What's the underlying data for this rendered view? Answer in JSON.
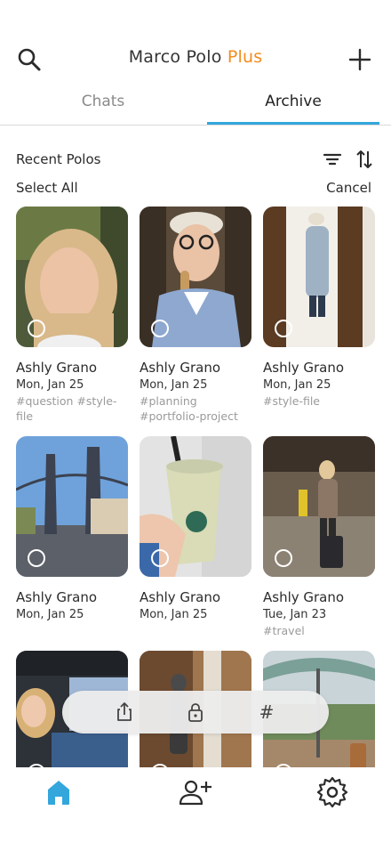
{
  "header": {
    "title_main": "Marco Polo",
    "title_plus": "Plus"
  },
  "tabs": [
    {
      "label": "Chats"
    },
    {
      "label": "Archive"
    }
  ],
  "section": {
    "title": "Recent Polos",
    "select_all": "Select All",
    "cancel": "Cancel"
  },
  "polos": [
    {
      "name": "Ashly Grano",
      "date": "Mon, Jan 25",
      "tags": "#question #style-file"
    },
    {
      "name": "Ashly Grano",
      "date": "Mon, Jan 25",
      "tags": "#planning #portfolio-project"
    },
    {
      "name": "Ashly Grano",
      "date": "Mon, Jan 25",
      "tags": "#style-file"
    },
    {
      "name": "Ashly Grano",
      "date": "Mon, Jan 25",
      "tags": ""
    },
    {
      "name": "Ashly Grano",
      "date": "Mon, Jan 25",
      "tags": ""
    },
    {
      "name": "Ashly Grano",
      "date": "Tue, Jan 23",
      "tags": "#travel"
    }
  ],
  "action_bar": {
    "icons": [
      "share-icon",
      "lock-icon",
      "hashtag-icon"
    ],
    "hashtag_glyph": "#"
  },
  "bottom_nav": {
    "items": [
      "home-icon",
      "add-friend-icon",
      "settings-icon"
    ]
  },
  "colors": {
    "accent_blue": "#33a6dc",
    "plus_orange": "#f28c1e",
    "tag_gray": "#9a9a9a"
  }
}
